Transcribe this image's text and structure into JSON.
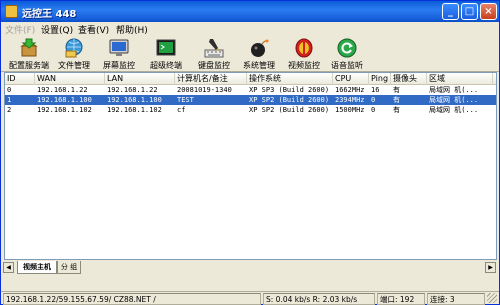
{
  "title": "远控王 448",
  "window_controls": {
    "minimize": "_",
    "maximize": "□",
    "close": "×"
  },
  "menu": [
    {
      "label": "文件(F)",
      "disabled": true
    },
    {
      "label": "设置(Q)"
    },
    {
      "label": "查看(V)"
    },
    {
      "label": "帮助(H)"
    }
  ],
  "toolbar": [
    {
      "label": "配置服务端",
      "icon": "package-icon"
    },
    {
      "label": "文件管理",
      "icon": "folder-globe-icon"
    },
    {
      "label": "屏幕监控",
      "icon": "monitor-icon"
    },
    {
      "label": "超级终端",
      "icon": "terminal-icon"
    },
    {
      "label": "键盘监控",
      "icon": "pen-keyboard-icon"
    },
    {
      "label": "系统管理",
      "icon": "bomb-icon"
    },
    {
      "label": "视频监控",
      "icon": "shield-icon"
    },
    {
      "label": "语音监听",
      "icon": "refresh-globe-icon"
    }
  ],
  "columns": [
    "ID",
    "WAN",
    "LAN",
    "计算机名/备注",
    "操作系统",
    "CPU",
    "Ping",
    "摄像头",
    "区域",
    "|"
  ],
  "rows": [
    {
      "id": "0",
      "wan": "192.168.1.22",
      "lan": "192.168.1.22",
      "name": "20081019-1340",
      "os": "XP SP3 (Build 2600)",
      "cpu": "1662MHz",
      "ping": "16",
      "cam": "有",
      "region": "局域网 机(..."
    },
    {
      "id": "1",
      "wan": "192.168.1.100",
      "lan": "192.168.1.100",
      "name": "TEST",
      "os": "XP SP2 (Build 2600)",
      "cpu": "2394MHz",
      "ping": "0",
      "cam": "有",
      "region": "局域网 机(...",
      "selected": true
    },
    {
      "id": "2",
      "wan": "192.168.1.102",
      "lan": "192.168.1.102",
      "name": "cf",
      "os": "XP SP2 (Build 2600)",
      "cpu": "1500MHz",
      "ping": "0",
      "cam": "有",
      "region": "局域网 机(..."
    }
  ],
  "tabs": [
    {
      "label": "视频主机",
      "active": true
    },
    {
      "label": "分 组",
      "active": false
    }
  ],
  "status": {
    "address": "192.168.1.22/59.155.67.59/ CZ88.NET /",
    "speed": "S: 0.04 kb/s R: 2.03 kb/s",
    "port": "端口: 192",
    "connections": "连接: 3"
  }
}
